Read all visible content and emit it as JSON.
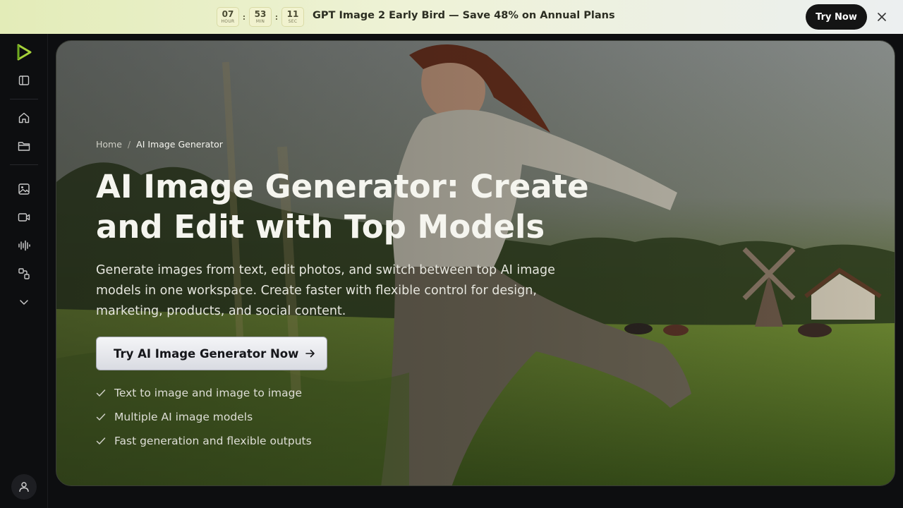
{
  "promo": {
    "timer": [
      {
        "value": "07",
        "unit": "HOUR"
      },
      {
        "value": "53",
        "unit": "MIN"
      },
      {
        "value": "11",
        "unit": "SEC"
      }
    ],
    "separator": ":",
    "message": "GPT Image 2 Early Bird — Save 48% on Annual Plans",
    "cta_label": "Try Now",
    "close_icon": "close-icon"
  },
  "sidebar": {
    "items": [
      {
        "icon": "logo-icon"
      },
      {
        "icon": "sidebar-toggle-icon"
      },
      {
        "icon": "home-icon"
      },
      {
        "icon": "folder-icon"
      },
      {
        "icon": "image-icon"
      },
      {
        "icon": "video-icon"
      },
      {
        "icon": "audio-waveform-icon"
      },
      {
        "icon": "tools-icon"
      },
      {
        "icon": "chevron-down-icon"
      },
      {
        "icon": "user-icon"
      }
    ]
  },
  "hero": {
    "breadcrumb": {
      "home": "Home",
      "separator": "/",
      "current": "AI Image Generator"
    },
    "title": "AI Image Generator: Create and Edit with Top Models",
    "description": "Generate images from text, edit photos, and switch between top AI image models in one workspace. Create faster with flexible control for design, marketing, products, and social content.",
    "cta_label": "Try AI Image Generator Now",
    "features": [
      "Text to image and image to image",
      "Multiple AI image models",
      "Fast generation and flexible outputs"
    ]
  },
  "colors": {
    "banner_start": "#e3ecb8",
    "banner_end": "#eceff0",
    "logo_accent": "#a6d23a",
    "page_bg": "#0d0e10"
  }
}
